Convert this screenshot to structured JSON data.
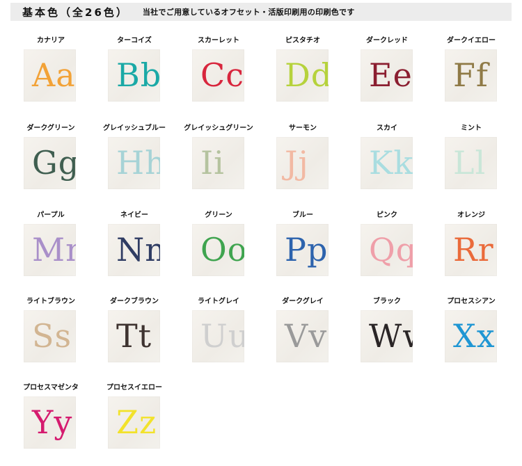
{
  "header": {
    "title": "基本色（全26色）",
    "subtitle": "当社でご用意しているオフセット・活版印刷用の印刷色です"
  },
  "colors": [
    {
      "name": "カナリア",
      "letters": "Aa",
      "hex": "#f2a237"
    },
    {
      "name": "ターコイズ",
      "letters": "Bb",
      "hex": "#1aa9a6"
    },
    {
      "name": "スカーレット",
      "letters": "Cc",
      "hex": "#d8263d"
    },
    {
      "name": "ピスタチオ",
      "letters": "Dd",
      "hex": "#b6d23c"
    },
    {
      "name": "ダークレッド",
      "letters": "Ee",
      "hex": "#8b1e30"
    },
    {
      "name": "ダークイエロー",
      "letters": "Ff",
      "hex": "#8f7a46"
    },
    {
      "name": "ダークグリーン",
      "letters": "Gg",
      "hex": "#3f5e50"
    },
    {
      "name": "グレイッシュブルー",
      "letters": "Hh",
      "hex": "#a6d3d6"
    },
    {
      "name": "グレイッシュグリーン",
      "letters": "Ii",
      "hex": "#b5c39f"
    },
    {
      "name": "サーモン",
      "letters": "Jj",
      "hex": "#f2b9a3"
    },
    {
      "name": "スカイ",
      "letters": "Kk",
      "hex": "#a9dde0"
    },
    {
      "name": "ミント",
      "letters": "Ll",
      "hex": "#c9e6d8"
    },
    {
      "name": "パープル",
      "letters": "Mm",
      "hex": "#a98fc9"
    },
    {
      "name": "ネイビー",
      "letters": "Nn",
      "hex": "#2f3c63"
    },
    {
      "name": "グリーン",
      "letters": "Oo",
      "hex": "#3fa44f"
    },
    {
      "name": "ブルー",
      "letters": "Pp",
      "hex": "#2d63ad"
    },
    {
      "name": "ピンク",
      "letters": "Qq",
      "hex": "#ef9fa9"
    },
    {
      "name": "オレンジ",
      "letters": "Rr",
      "hex": "#ea6a3a"
    },
    {
      "name": "ライトブラウン",
      "letters": "Ss",
      "hex": "#d2b592"
    },
    {
      "name": "ダークブラウン",
      "letters": "Tt",
      "hex": "#3e3330"
    },
    {
      "name": "ライトグレイ",
      "letters": "Uu",
      "hex": "#cfcfcf"
    },
    {
      "name": "ダークグレイ",
      "letters": "Vv",
      "hex": "#9a9a9a"
    },
    {
      "name": "ブラック",
      "letters": "Ww",
      "hex": "#2a2526"
    },
    {
      "name": "プロセスシアン",
      "letters": "Xx",
      "hex": "#1f96d3"
    },
    {
      "name": "プロセスマゼンタ",
      "letters": "Yy",
      "hex": "#d51b6f"
    },
    {
      "name": "プロセスイエロー",
      "letters": "Zz",
      "hex": "#f2e22b"
    }
  ]
}
